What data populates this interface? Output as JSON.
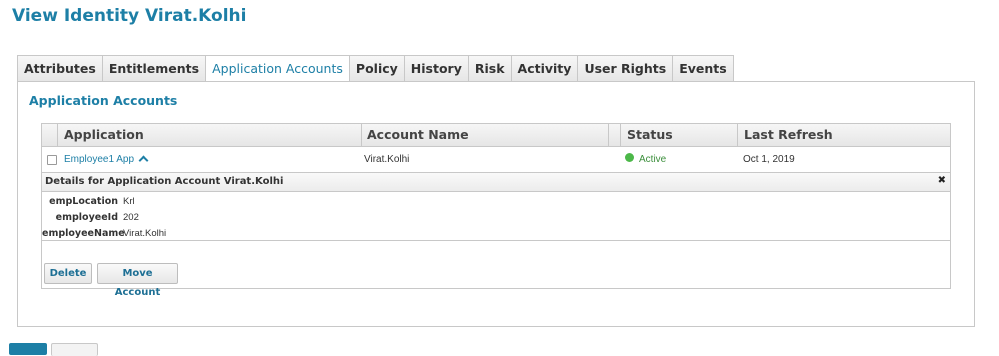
{
  "page": {
    "title": "View Identity Virat.Kolhi"
  },
  "tabs": [
    {
      "label": "Attributes"
    },
    {
      "label": "Entitlements"
    },
    {
      "label": "Application Accounts",
      "active": true
    },
    {
      "label": "Policy"
    },
    {
      "label": "History"
    },
    {
      "label": "Risk"
    },
    {
      "label": "Activity"
    },
    {
      "label": "User Rights"
    },
    {
      "label": "Events"
    }
  ],
  "section": {
    "title": "Application Accounts"
  },
  "table": {
    "columns": [
      "Application",
      "Account Name",
      "Status",
      "Last Refresh"
    ],
    "rows": [
      {
        "application": "Employee1 App",
        "account_name": "Virat.Kolhi",
        "status": "Active",
        "last_refresh": "Oct 1, 2019"
      }
    ]
  },
  "details": {
    "title": "Details for Application Account Virat.Kolhi",
    "close": "✖",
    "attributes": [
      {
        "key": "empLocation",
        "value": "Krl"
      },
      {
        "key": "employeeId",
        "value": "202"
      },
      {
        "key": "employeeName",
        "value": "Virat.Kolhi"
      }
    ]
  },
  "actions": {
    "delete_label": "Delete",
    "move_label": "Move Account"
  },
  "colors": {
    "accent": "#1d7fa6",
    "status_active": "#4cb849",
    "border": "#c8c8c8"
  },
  "icons": {
    "expand": "chevron-up-icon",
    "close": "close-icon",
    "status": "status-dot-icon"
  }
}
